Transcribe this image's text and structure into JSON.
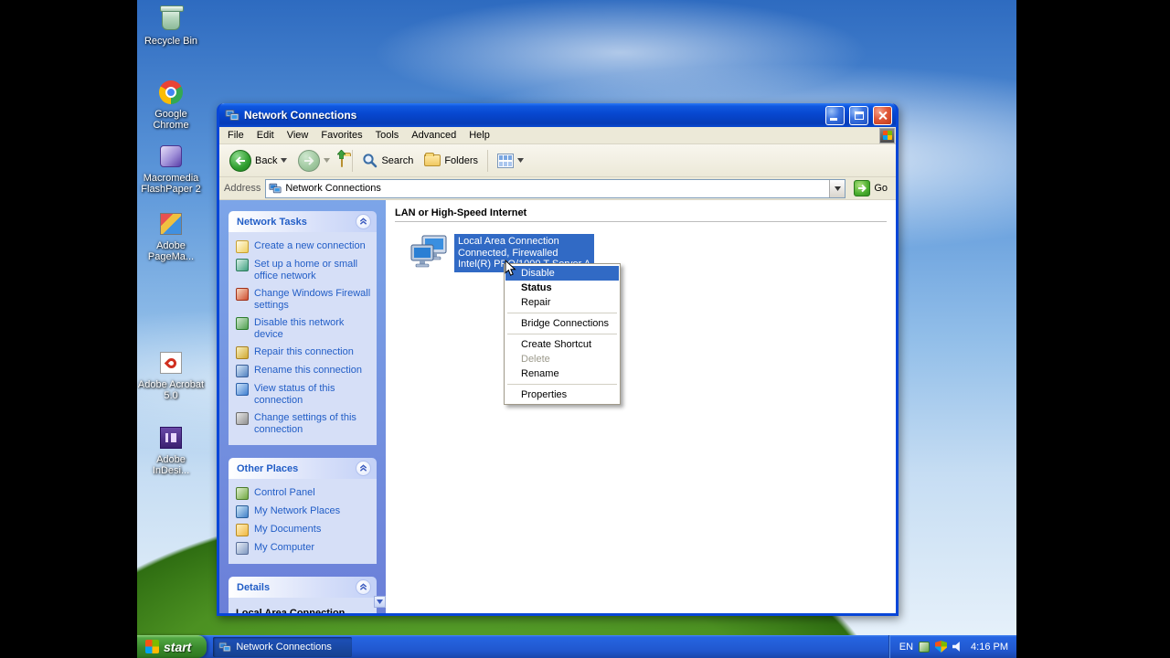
{
  "desktop": {
    "icons": [
      {
        "label": "Recycle Bin",
        "icon": "recycle-bin-icon"
      },
      {
        "label": "Google Chrome",
        "icon": "chrome-icon"
      },
      {
        "label": "Macromedia FlashPaper 2",
        "icon": "flashpaper-icon"
      },
      {
        "label": "Adobe PageMa...",
        "icon": "pagemaker-icon"
      },
      {
        "label": "Adobe Acrobat 5.0",
        "icon": "acrobat-icon"
      },
      {
        "label": "Adobe InDesi...",
        "icon": "indesign-icon"
      }
    ]
  },
  "window": {
    "title": "Network Connections",
    "menu": {
      "items": [
        "File",
        "Edit",
        "View",
        "Favorites",
        "Tools",
        "Advanced",
        "Help"
      ]
    },
    "toolbar": {
      "back_label": "Back",
      "search_label": "Search",
      "folders_label": "Folders"
    },
    "address_bar": {
      "label": "Address",
      "value": "Network Connections",
      "go_label": "Go"
    },
    "task_pane": {
      "network_tasks": {
        "title": "Network Tasks",
        "items": [
          "Create a new connection",
          "Set up a home or small office network",
          "Change Windows Firewall settings",
          "Disable this network device",
          "Repair this connection",
          "Rename this connection",
          "View status of this connection",
          "Change settings of this connection"
        ]
      },
      "other_places": {
        "title": "Other Places",
        "items": [
          "Control Panel",
          "My Network Places",
          "My Documents",
          "My Computer"
        ]
      },
      "details": {
        "title": "Details",
        "connection_name": "Local Area Connection"
      }
    },
    "content": {
      "group_header": "LAN or High-Speed Internet",
      "connection": {
        "name": "Local Area Connection",
        "status": "Connected, Firewalled",
        "device": "Intel(R) PRO/1000 T Server A"
      }
    }
  },
  "context_menu": {
    "items": [
      {
        "label": "Disable",
        "state": "highlighted"
      },
      {
        "label": "Status",
        "state": "default-bold"
      },
      {
        "label": "Repair",
        "state": "normal"
      },
      {
        "label": "Bridge Connections",
        "state": "normal"
      },
      {
        "label": "Create Shortcut",
        "state": "normal"
      },
      {
        "label": "Delete",
        "state": "disabled"
      },
      {
        "label": "Rename",
        "state": "normal"
      },
      {
        "label": "Properties",
        "state": "normal"
      }
    ]
  },
  "taskbar": {
    "start_label": "start",
    "buttons": [
      {
        "label": "Network Connections"
      }
    ],
    "tray": {
      "language": "EN",
      "time": "4:16 PM"
    }
  },
  "colors": {
    "selection_blue": "#316AC5",
    "titlebar_blue": "#0846D8",
    "taskpane_link_blue": "#215DC6",
    "taskpane_body": "#D6DFF7",
    "start_green": "#3A8A2C"
  }
}
